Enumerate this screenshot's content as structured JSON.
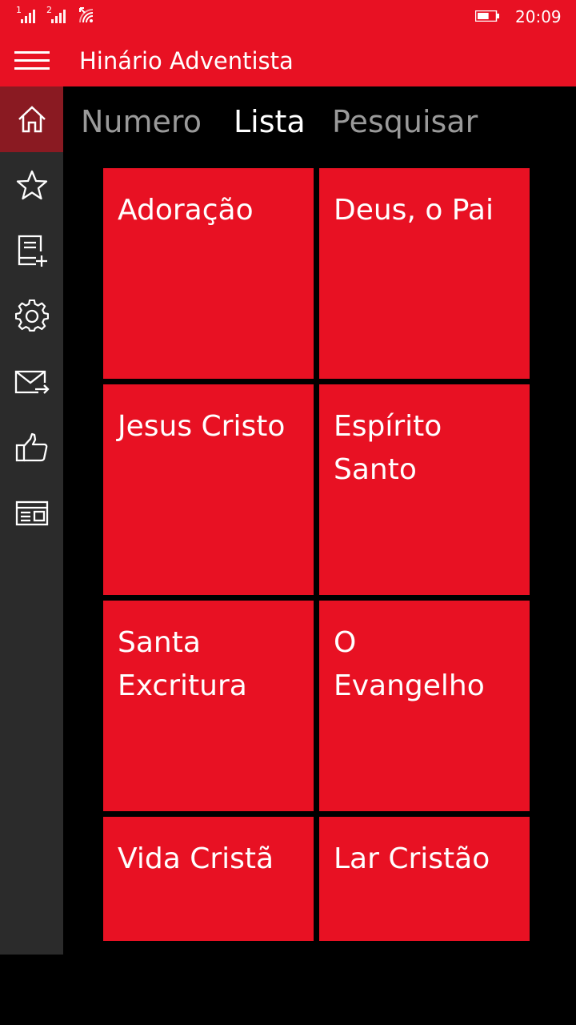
{
  "status": {
    "sim1": "1",
    "sim2": "2",
    "time": "20:09",
    "battery_level": 0.65
  },
  "header": {
    "title": "Hinário Adventista",
    "menu_icon": "hamburger-icon"
  },
  "sidebar": {
    "items": [
      {
        "icon": "home-icon",
        "active": true
      },
      {
        "icon": "star-icon",
        "active": false
      },
      {
        "icon": "add-note-icon",
        "active": false
      },
      {
        "icon": "gear-icon",
        "active": false
      },
      {
        "icon": "mail-send-icon",
        "active": false
      },
      {
        "icon": "thumbs-up-icon",
        "active": false
      },
      {
        "icon": "news-icon",
        "active": false
      }
    ]
  },
  "tabs": [
    {
      "label": "Numero",
      "active": false
    },
    {
      "label": "Lista",
      "active": true
    },
    {
      "label": "Pesquisar",
      "active": false
    }
  ],
  "categories": [
    {
      "line1": "Adoração",
      "line2": ""
    },
    {
      "line1": "Deus, o Pai",
      "line2": ""
    },
    {
      "line1": "Jesus Cristo",
      "line2": ""
    },
    {
      "line1": "Espírito",
      "line2": "Santo"
    },
    {
      "line1": "Santa",
      "line2": "Excritura"
    },
    {
      "line1": "O",
      "line2": "Evangelho"
    },
    {
      "line1": "Vida Cristã",
      "line2": ""
    },
    {
      "line1": "Lar Cristão",
      "line2": ""
    }
  ],
  "colors": {
    "accent": "#e81123",
    "sidebar": "#2b2b2b",
    "sidebar_active": "#8a1a22",
    "background": "#000000"
  }
}
